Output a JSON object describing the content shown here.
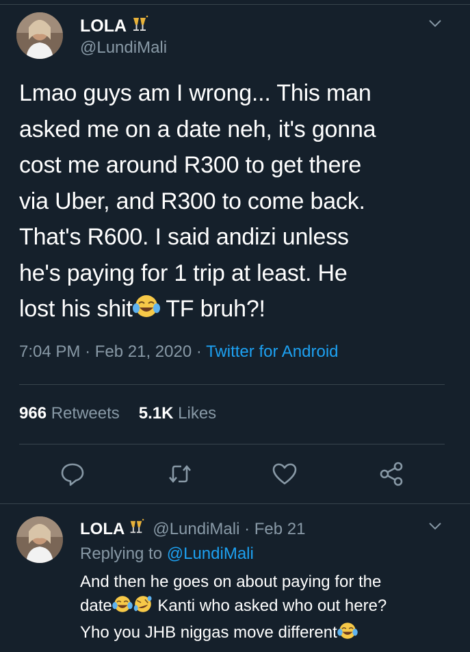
{
  "tweet": {
    "author_name": "LOLA",
    "author_handle": "@LundiMali",
    "text_lines": [
      "Lmao guys am I wrong... This man",
      "asked me on a date neh, it's gonna",
      "cost me around R300 to get there",
      "via Uber, and R300 to come back.",
      "That's R600. I said andizi unless",
      "he's paying for 1 trip at least. He"
    ],
    "last_line_before_emoji": "lost his shit",
    "last_line_after_emoji": " TF bruh?!",
    "time": "7:04 PM",
    "date": "Feb 21, 2020",
    "separator": "·",
    "source": "Twitter for Android",
    "retweets_count": "966",
    "retweets_label": "Retweets",
    "likes_count": "5.1K",
    "likes_label": "Likes"
  },
  "actions": {
    "reply_icon": "reply-icon",
    "retweet_icon": "retweet-icon",
    "like_icon": "heart-icon",
    "share_icon": "share-icon"
  },
  "reply": {
    "author_name": "LOLA",
    "author_handle_date": "@LundiMali · Feb 21",
    "replying_prefix": "Replying to ",
    "replying_to": "@LundiMali",
    "line1": "And then he goes on about paying for the",
    "line2_before": "date",
    "line2_after": " Kanti who asked who out here?",
    "line3_before": "Yho you JHB niggas move different"
  },
  "colors": {
    "background": "#15202b",
    "text_primary": "#ffffff",
    "text_secondary": "#8899a6",
    "accent": "#1da1f2",
    "divider": "#38444d"
  }
}
